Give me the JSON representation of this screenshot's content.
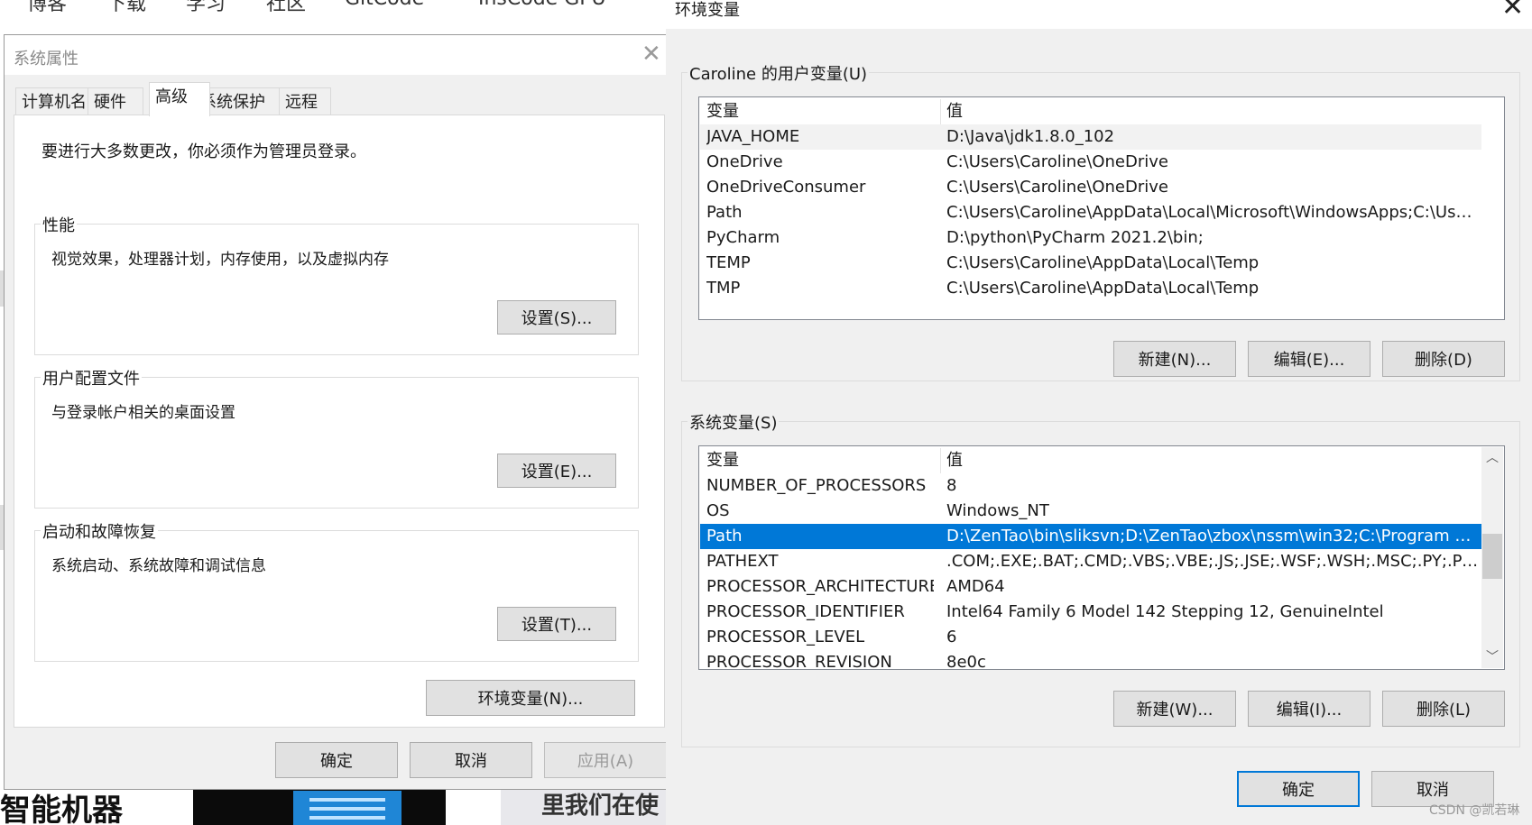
{
  "background_page": {
    "nav": [
      "博客",
      "下载",
      "学习",
      "社区",
      "GitCode",
      "InsCode GPU"
    ],
    "bottom_left_text": "智能机器",
    "bottom_right_text": "里我们在使"
  },
  "system_properties": {
    "title": "系统属性",
    "tabs": [
      {
        "label": "计算机名",
        "active": false
      },
      {
        "label": "硬件",
        "active": false
      },
      {
        "label": "高级",
        "active": true
      },
      {
        "label": "系统保护",
        "active": false
      },
      {
        "label": "远程",
        "active": false
      }
    ],
    "intro": "要进行大多数更改，你必须作为管理员登录。",
    "groups": [
      {
        "legend": "性能",
        "description": "视觉效果，处理器计划，内存使用，以及虚拟内存",
        "button": "设置(S)..."
      },
      {
        "legend": "用户配置文件",
        "description": "与登录帐户相关的桌面设置",
        "button": "设置(E)..."
      },
      {
        "legend": "启动和故障恢复",
        "description": "系统启动、系统故障和调试信息",
        "button": "设置(T)..."
      }
    ],
    "env_button": "环境变量(N)...",
    "ok": "确定",
    "cancel": "取消",
    "apply": "应用(A)"
  },
  "env_vars": {
    "title": "环境变量",
    "user_section": {
      "legend": "Caroline 的用户变量(U)",
      "headers": {
        "name": "变量",
        "value": "值"
      },
      "rows": [
        {
          "name": "JAVA_HOME",
          "value": "D:\\Java\\jdk1.8.0_102"
        },
        {
          "name": "OneDrive",
          "value": "C:\\Users\\Caroline\\OneDrive"
        },
        {
          "name": "OneDriveConsumer",
          "value": "C:\\Users\\Caroline\\OneDrive"
        },
        {
          "name": "Path",
          "value": "C:\\Users\\Caroline\\AppData\\Local\\Microsoft\\WindowsApps;C:\\User..."
        },
        {
          "name": "PyCharm",
          "value": "D:\\python\\PyCharm 2021.2\\bin;"
        },
        {
          "name": "TEMP",
          "value": "C:\\Users\\Caroline\\AppData\\Local\\Temp"
        },
        {
          "name": "TMP",
          "value": "C:\\Users\\Caroline\\AppData\\Local\\Temp"
        }
      ],
      "buttons": {
        "new": "新建(N)...",
        "edit": "编辑(E)...",
        "delete": "删除(D)"
      }
    },
    "system_section": {
      "legend": "系统变量(S)",
      "headers": {
        "name": "变量",
        "value": "值"
      },
      "rows": [
        {
          "name": "NUMBER_OF_PROCESSORS",
          "value": "8"
        },
        {
          "name": "OS",
          "value": "Windows_NT"
        },
        {
          "name": "Path",
          "value": "D:\\ZenTao\\bin\\sliksvn;D:\\ZenTao\\zbox\\nssm\\win32;C:\\Program Fil..."
        },
        {
          "name": "PATHEXT",
          "value": ".COM;.EXE;.BAT;.CMD;.VBS;.VBE;.JS;.JSE;.WSF;.WSH;.MSC;.PY;.PYW"
        },
        {
          "name": "PROCESSOR_ARCHITECTURE",
          "value": "AMD64"
        },
        {
          "name": "PROCESSOR_IDENTIFIER",
          "value": "Intel64 Family 6 Model 142 Stepping 12, GenuineIntel"
        },
        {
          "name": "PROCESSOR_LEVEL",
          "value": "6"
        },
        {
          "name": "PROCESSOR_REVISION",
          "value": "8e0c"
        }
      ],
      "selected_row": "Path",
      "buttons": {
        "new": "新建(W)...",
        "edit": "编辑(I)...",
        "delete": "删除(L)"
      }
    },
    "ok": "确定",
    "cancel": "取消"
  },
  "watermark": "CSDN @凯若琳",
  "colors": {
    "selection": "#0078d7",
    "dialog_bg": "#f0f0f0",
    "button_bg": "#e1e1e1"
  }
}
